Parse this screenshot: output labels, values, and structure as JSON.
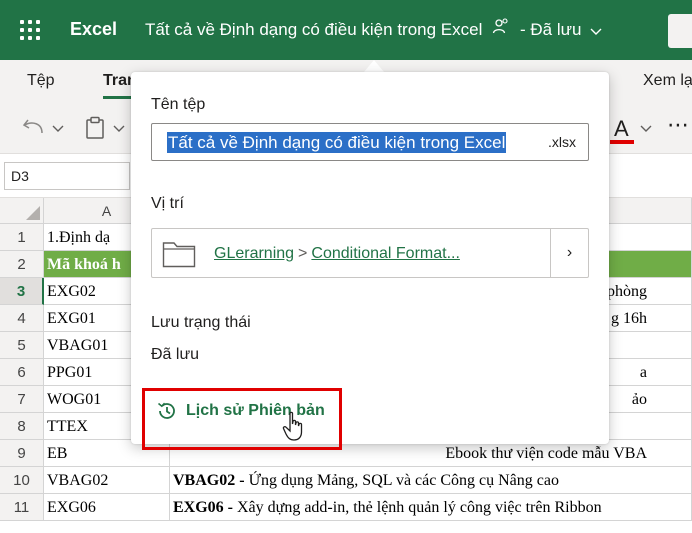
{
  "titlebar": {
    "app_name": "Excel",
    "doc_title": "Tất cả về Định dạng có điều kiện trong Excel",
    "save_status": "- Đã lưu",
    "icons": {
      "menu": "waffle-icon",
      "share": "people-icon",
      "dropdown": "chevron-down-icon"
    }
  },
  "ribbon": {
    "tabs": [
      "Tệp",
      "Tran",
      "Xem lạ"
    ],
    "tools": {
      "undo": "undo-icon",
      "paste": "clipboard-icon",
      "font_color": "A",
      "more": "⋯"
    }
  },
  "namebox": {
    "value": "D3"
  },
  "grid": {
    "columns": [
      "A"
    ],
    "rows": [
      {
        "num": "1",
        "a": "1.Định dạ",
        "rest": ""
      },
      {
        "num": "2",
        "a": "Mã khoá h",
        "rest": ""
      },
      {
        "num": "3",
        "a": "EXG02",
        "rest": "phòng"
      },
      {
        "num": "4",
        "a": "EXG01",
        "rest": "g 16h"
      },
      {
        "num": "5",
        "a": "VBAG01",
        "rest": ""
      },
      {
        "num": "6",
        "a": "PPG01",
        "rest": "a"
      },
      {
        "num": "7",
        "a": "WOG01",
        "rest": "ảo"
      },
      {
        "num": "8",
        "a": "TTEX",
        "rest": ""
      },
      {
        "num": "9",
        "a": "EB",
        "rest": "Ebook thư viện code mẫu VBA"
      },
      {
        "num": "10",
        "a": "VBAG02",
        "rest_bold": "VBAG02 -",
        "rest": " Ứng dụng Mảng, SQL và các Công cụ Nâng cao"
      },
      {
        "num": "11",
        "a": "EXG06",
        "rest_bold": "EXG06 -",
        "rest": " Xây dựng add-in, thẻ lệnh quản lý công việc trên Ribbon"
      }
    ],
    "selected_row": "3"
  },
  "popup": {
    "filename_label": "Tên tệp",
    "filename_value": "Tất cả về Định dạng có điều kiện trong Excel",
    "filename_ext": ".xlsx",
    "location_label": "Vị trí",
    "location_parts": [
      "GLerarning",
      "Conditional Format..."
    ],
    "location_separator": ">",
    "location_chevron": "›",
    "status_label": "Lưu trạng thái",
    "status_value": "Đã lưu",
    "history_link": "Lịch sử Phiên bản"
  },
  "colors": {
    "excel_green": "#217346",
    "header_fill": "#70ad47",
    "selection_blue": "#2b6fc7",
    "highlight_red": "#e00000"
  }
}
